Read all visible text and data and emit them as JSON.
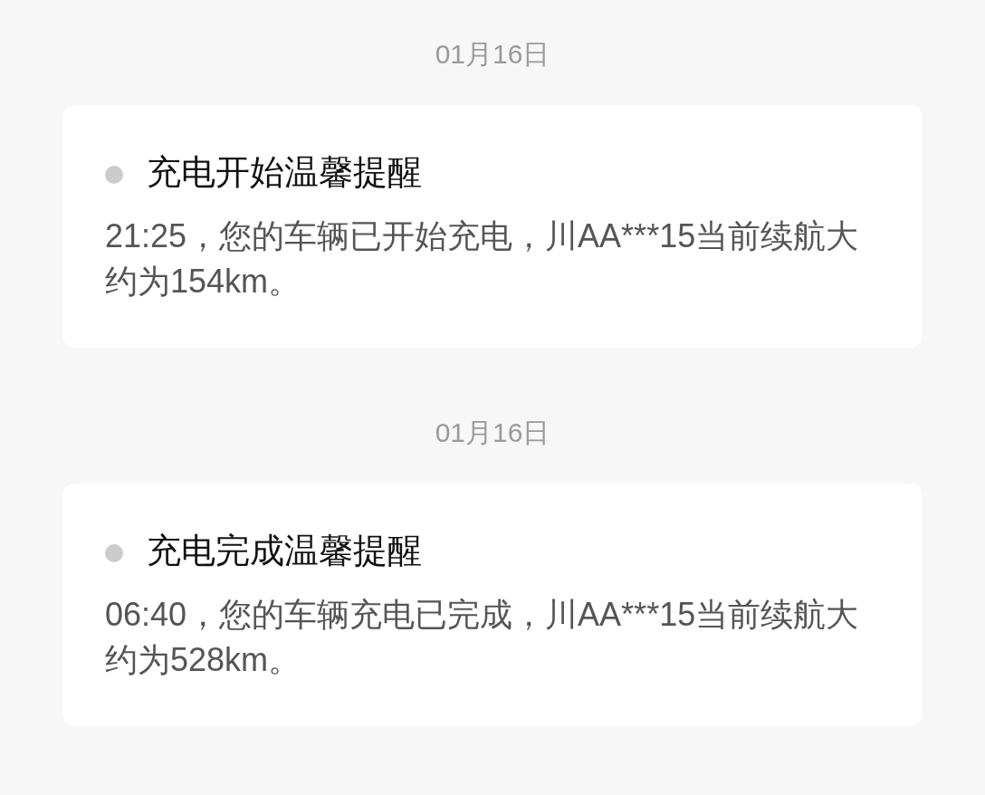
{
  "messages": [
    {
      "date": "01月16日",
      "title": "充电开始温馨提醒",
      "body": "21:25，您的车辆已开始充电，川AA***15当前续航大约为154km。"
    },
    {
      "date": "01月16日",
      "title": "充电完成温馨提醒",
      "body": "06:40，您的车辆充电已完成，川AA***15当前续航大约为528km。"
    }
  ]
}
